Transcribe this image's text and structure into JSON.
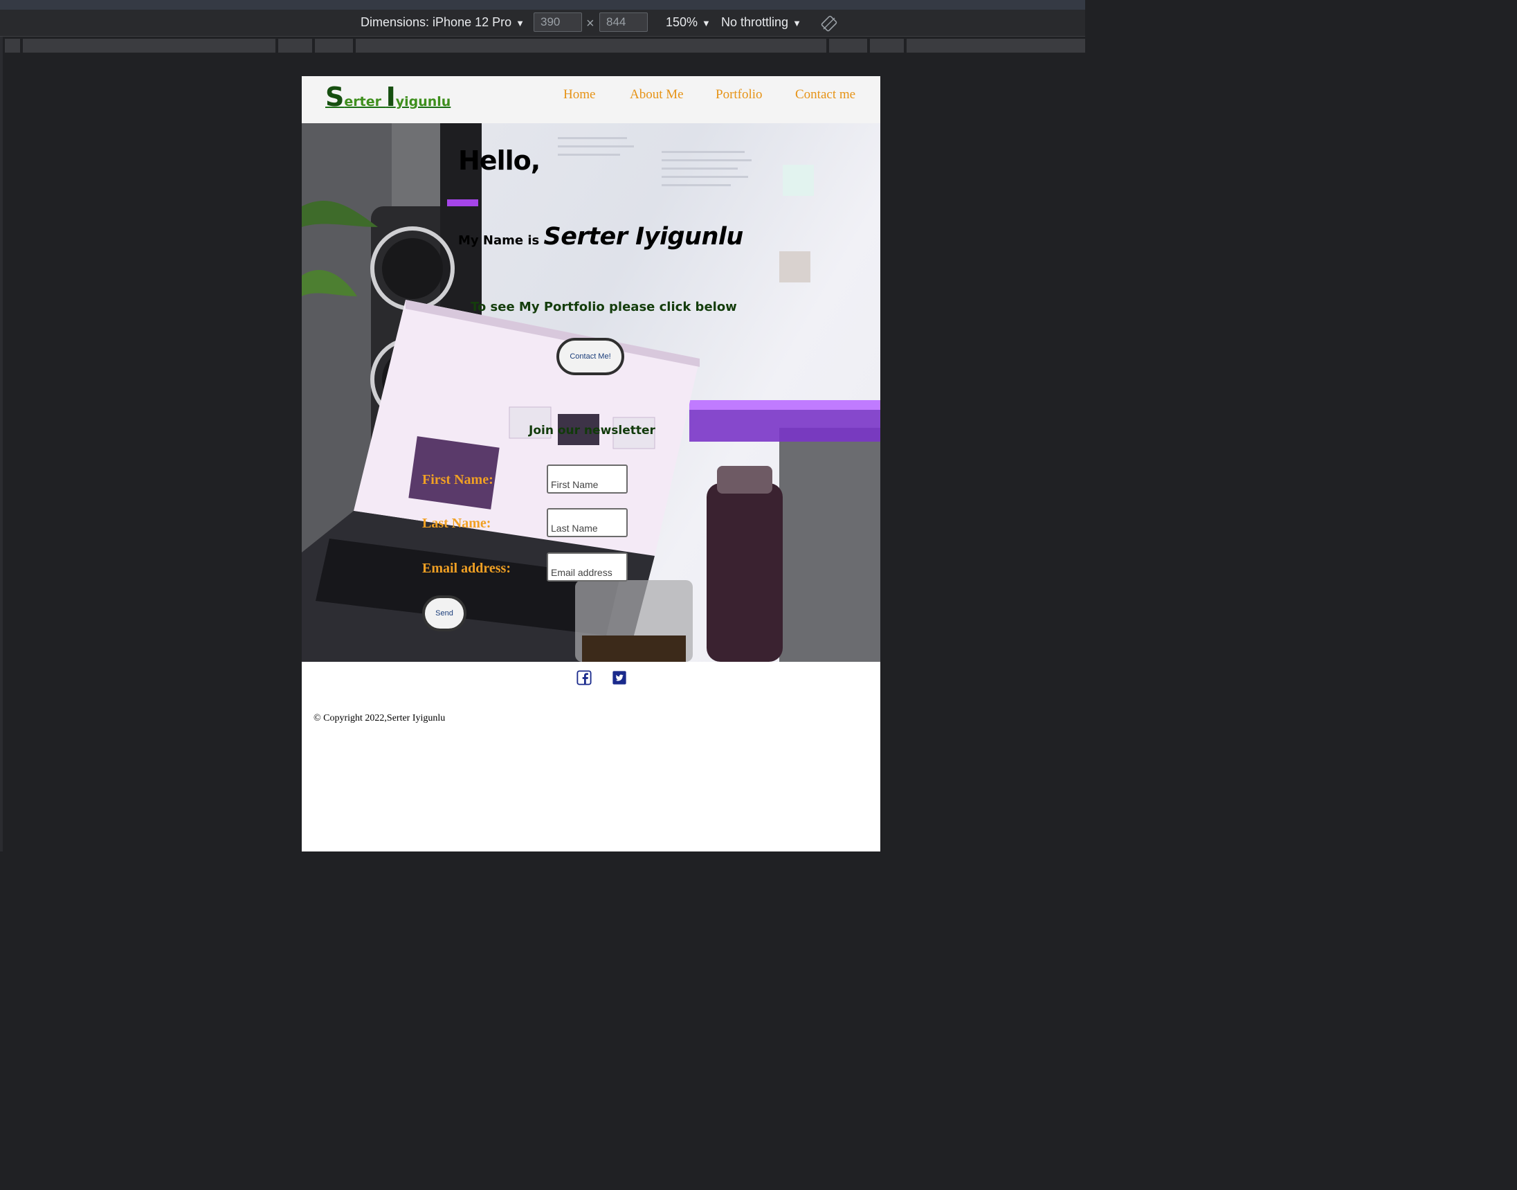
{
  "devtools": {
    "dimensions_label": "Dimensions: iPhone 12 Pro",
    "width_value": "390",
    "height_value": "844",
    "times_symbol": "×",
    "zoom": "150%",
    "throttling": "No throttling",
    "caret": "▼"
  },
  "nav": {
    "logo_s": "S",
    "logo_erter": "erter ",
    "logo_i": "I",
    "logo_yigunlu": "yigunlu",
    "links": [
      "Home",
      "About Me",
      "Portfolio",
      "Contact me"
    ]
  },
  "hero": {
    "hello": "Hello,",
    "name_prefix": "My Name is ",
    "name": "Serter Iyigunlu",
    "portfolio_prompt": "To see My Portfolio please click below",
    "contact_button": "Contact Me!"
  },
  "newsletter": {
    "title": "Join our newsletter",
    "first_name_label": "First Name:",
    "first_name_placeholder": "First Name",
    "last_name_label": "Last Name:",
    "last_name_placeholder": "Last Name",
    "email_label": "Email address:",
    "email_placeholder": "Email address",
    "send_button": "Send"
  },
  "footer": {
    "social_icons": [
      "facebook-icon",
      "twitter-icon"
    ],
    "social_color": "#1a2a8c",
    "copyright": "© Copyright 2022,Serter Iyigunlu"
  },
  "colors": {
    "nav_link": "#e69316",
    "logo_green": "#1b6e14",
    "label_orange": "#f0a024",
    "heading_green": "#143d0c"
  }
}
